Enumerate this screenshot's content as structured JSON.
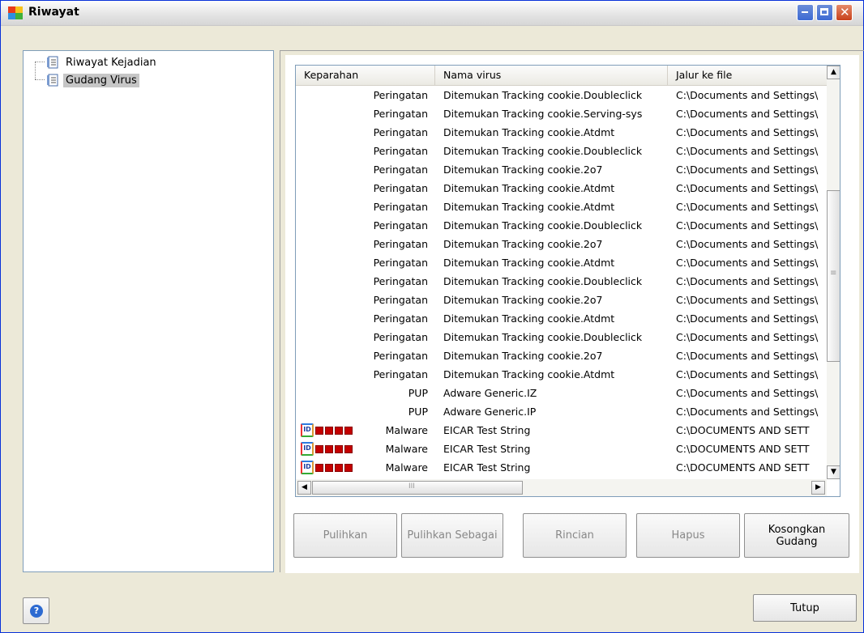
{
  "window": {
    "title": "Riwayat"
  },
  "tree": {
    "items": [
      {
        "label": "Riwayat Kejadian",
        "selected": false
      },
      {
        "label": "Gudang Virus",
        "selected": true
      }
    ]
  },
  "list": {
    "columns": [
      "Keparahan",
      "Nama virus",
      "Jalur ke file"
    ],
    "rows": [
      {
        "severity": "Peringatan",
        "name": "Ditemukan Tracking cookie.Doubleclick",
        "path": "C:\\Documents and Settings\\"
      },
      {
        "severity": "Peringatan",
        "name": "Ditemukan Tracking cookie.Serving-sys",
        "path": "C:\\Documents and Settings\\"
      },
      {
        "severity": "Peringatan",
        "name": "Ditemukan Tracking cookie.Atdmt",
        "path": "C:\\Documents and Settings\\"
      },
      {
        "severity": "Peringatan",
        "name": "Ditemukan Tracking cookie.Doubleclick",
        "path": "C:\\Documents and Settings\\"
      },
      {
        "severity": "Peringatan",
        "name": "Ditemukan Tracking cookie.2o7",
        "path": "C:\\Documents and Settings\\"
      },
      {
        "severity": "Peringatan",
        "name": "Ditemukan Tracking cookie.Atdmt",
        "path": "C:\\Documents and Settings\\"
      },
      {
        "severity": "Peringatan",
        "name": "Ditemukan Tracking cookie.Atdmt",
        "path": "C:\\Documents and Settings\\"
      },
      {
        "severity": "Peringatan",
        "name": "Ditemukan Tracking cookie.Doubleclick",
        "path": "C:\\Documents and Settings\\"
      },
      {
        "severity": "Peringatan",
        "name": "Ditemukan Tracking cookie.2o7",
        "path": "C:\\Documents and Settings\\"
      },
      {
        "severity": "Peringatan",
        "name": "Ditemukan Tracking cookie.Atdmt",
        "path": "C:\\Documents and Settings\\"
      },
      {
        "severity": "Peringatan",
        "name": "Ditemukan Tracking cookie.Doubleclick",
        "path": "C:\\Documents and Settings\\"
      },
      {
        "severity": "Peringatan",
        "name": "Ditemukan Tracking cookie.2o7",
        "path": "C:\\Documents and Settings\\"
      },
      {
        "severity": "Peringatan",
        "name": "Ditemukan Tracking cookie.Atdmt",
        "path": "C:\\Documents and Settings\\"
      },
      {
        "severity": "Peringatan",
        "name": "Ditemukan Tracking cookie.Doubleclick",
        "path": "C:\\Documents and Settings\\"
      },
      {
        "severity": "Peringatan",
        "name": "Ditemukan Tracking cookie.2o7",
        "path": "C:\\Documents and Settings\\"
      },
      {
        "severity": "Peringatan",
        "name": "Ditemukan Tracking cookie.Atdmt",
        "path": "C:\\Documents and Settings\\"
      },
      {
        "severity": "PUP",
        "name": "Adware Generic.IZ",
        "path": "C:\\Documents and Settings\\"
      },
      {
        "severity": "PUP",
        "name": "Adware Generic.IP",
        "path": "C:\\Documents and Settings\\"
      },
      {
        "severity": "Malware",
        "name": "EICAR Test String",
        "path": "C:\\DOCUMENTS AND SETT",
        "icon": "id-badge-icon"
      },
      {
        "severity": "Malware",
        "name": "EICAR Test String",
        "path": "C:\\DOCUMENTS AND SETT",
        "icon": "id-badge-icon"
      },
      {
        "severity": "Malware",
        "name": "EICAR Test String",
        "path": "C:\\DOCUMENTS AND SETT",
        "icon": "id-badge-icon"
      }
    ]
  },
  "buttons": {
    "restore": "Pulihkan",
    "restore_as": "Pulihkan Sebagai",
    "details": "Rincian",
    "delete": "Hapus",
    "empty": "Kosongkan Gudang",
    "close": "Tutup"
  },
  "icons": {
    "help": "?",
    "scroll_up": "▲",
    "scroll_down": "▼",
    "scroll_left": "◀",
    "scroll_right": "▶",
    "grip": "≡",
    "hgrip": "III"
  },
  "colors": {
    "accent": "#0831d9",
    "malware_red": "#c40000"
  }
}
